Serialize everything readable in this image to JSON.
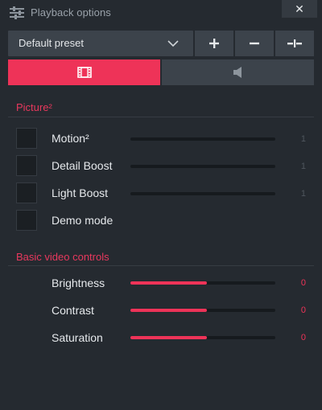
{
  "window": {
    "title": "Playback options",
    "close_glyph": "✕"
  },
  "preset": {
    "selected": "Default preset"
  },
  "toolbar": {
    "add_glyph": "+",
    "remove_glyph": "−"
  },
  "tabs": [
    {
      "icon": "film-icon",
      "active": true
    },
    {
      "icon": "speaker-icon",
      "active": false
    }
  ],
  "picture": {
    "title": "Picture²",
    "items": [
      {
        "label": "Motion²",
        "checked": false,
        "has_slider": true,
        "value": "1",
        "level": 0
      },
      {
        "label": "Detail Boost",
        "checked": false,
        "has_slider": true,
        "value": "1",
        "level": 0
      },
      {
        "label": "Light Boost",
        "checked": false,
        "has_slider": true,
        "value": "1",
        "level": 0
      },
      {
        "label": "Demo mode",
        "checked": false,
        "has_slider": false
      }
    ]
  },
  "basic": {
    "title": "Basic video controls",
    "items": [
      {
        "label": "Brightness",
        "value": "0",
        "level": 0.53
      },
      {
        "label": "Contrast",
        "value": "0",
        "level": 0.53
      },
      {
        "label": "Saturation",
        "value": "0",
        "level": 0.53
      }
    ]
  },
  "colors": {
    "accent": "#ee3358",
    "background": "#252a30",
    "control": "#3c434b"
  }
}
